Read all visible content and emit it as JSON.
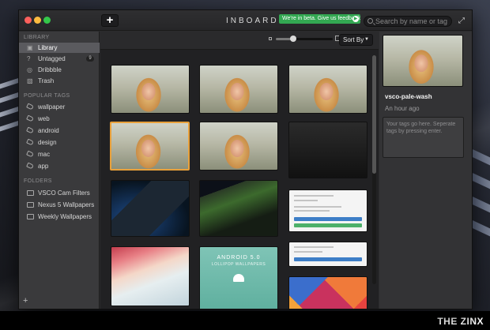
{
  "window": {
    "title": "INBOARD",
    "add_label": "+",
    "beta_banner": "We're in beta. Give us feedback",
    "search_placeholder": "Search by name or tag"
  },
  "sidebar": {
    "library_header": "LIBRARY",
    "library_items": [
      {
        "label": "Library",
        "icon": "photo-stack-icon",
        "active": true
      },
      {
        "label": "Untagged",
        "icon": "question-circle-icon",
        "count": "9"
      },
      {
        "label": "Dribbble",
        "icon": "dribbble-icon"
      },
      {
        "label": "Trash",
        "icon": "trash-icon"
      }
    ],
    "tags_header": "POPULAR TAGS",
    "tags": [
      "wallpaper",
      "web",
      "android",
      "design",
      "mac",
      "app"
    ],
    "folders_header": "FOLDERS",
    "folders": [
      "VSCO Cam Filters",
      "Nexus 5 Wallpapers",
      "Weekly Wallpapers"
    ],
    "add_label": "+"
  },
  "toolbar": {
    "sort_label": "Sort By",
    "thumbnail_size_level": 0.3
  },
  "grid": {
    "android_tile_title": "ANDROID 5.0",
    "android_tile_subtitle": "LOLLIPOP WALLPAPERS"
  },
  "detail": {
    "name": "vsco-pale-wash",
    "time": "An hour ago",
    "tags_placeholder": "Your tags go here. Seperate tags by pressing enter."
  },
  "watermark": "THE ZINX",
  "colors": {
    "selection": "#e9a13b",
    "beta_green": "#33a852",
    "close": "#fc605c",
    "minimize": "#fdbc40",
    "maximize": "#34c84a"
  }
}
